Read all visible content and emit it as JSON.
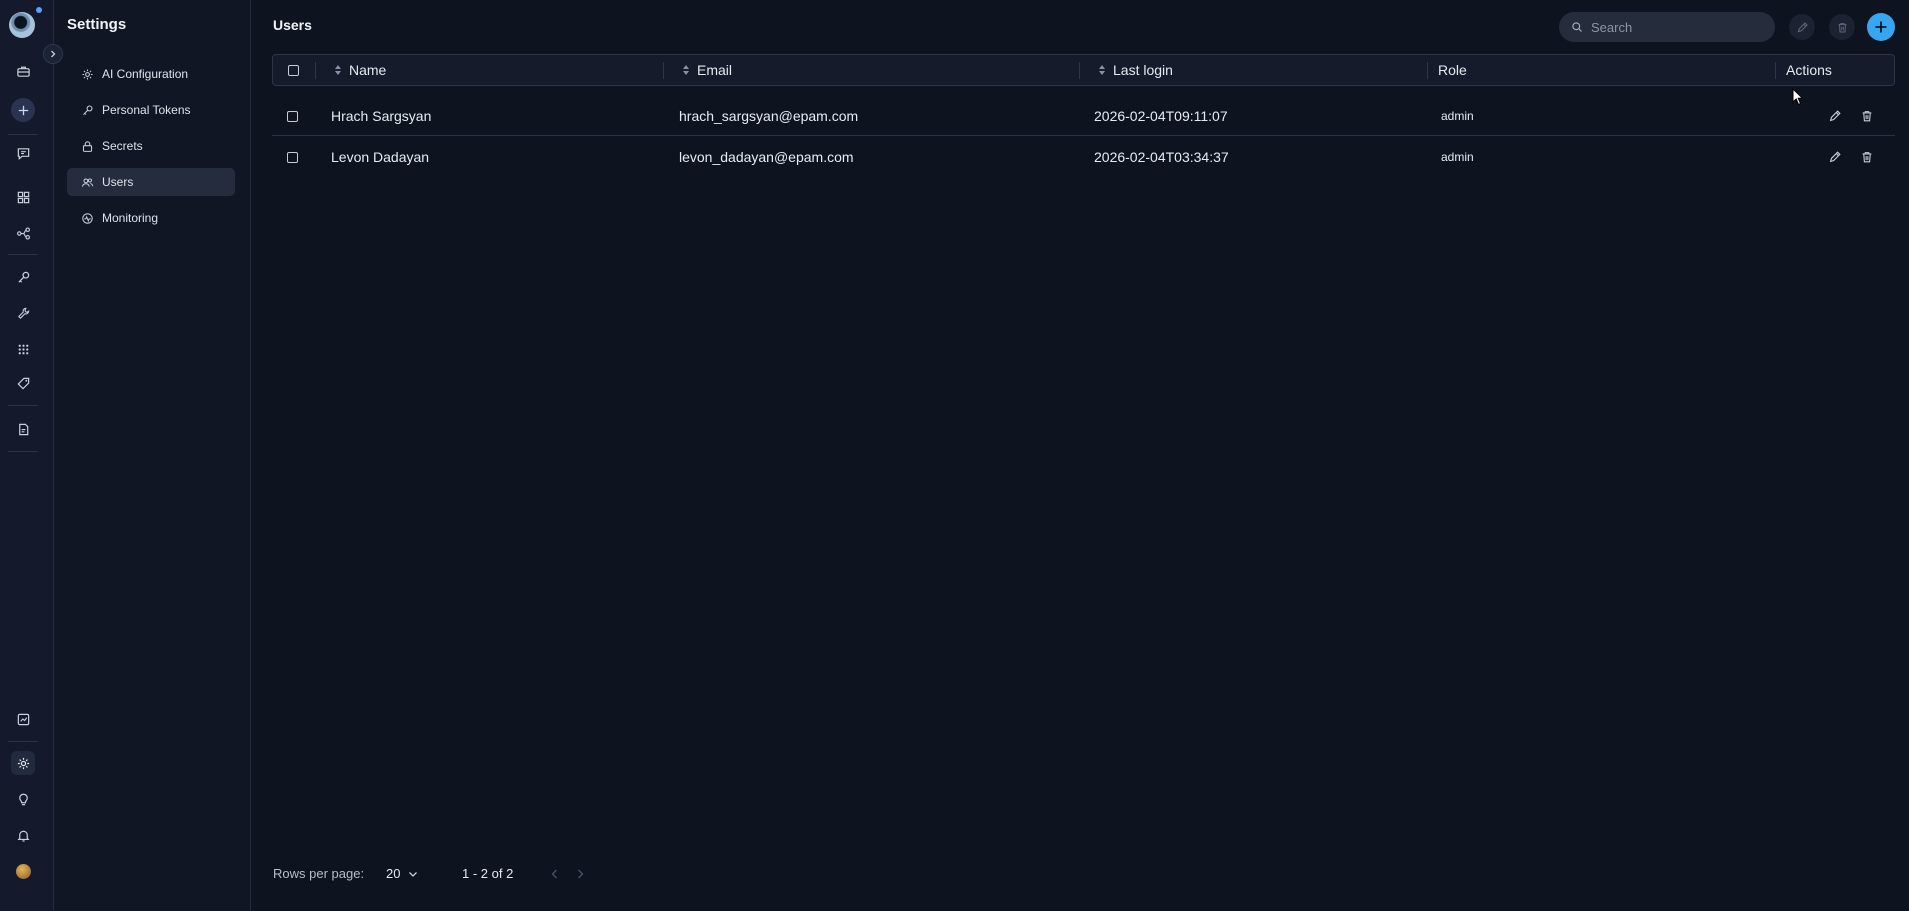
{
  "sidebar": {
    "title": "Settings",
    "items": [
      {
        "label": "AI Configuration",
        "icon": "gear-icon"
      },
      {
        "label": "Personal Tokens",
        "icon": "key-icon"
      },
      {
        "label": "Secrets",
        "icon": "lock-icon"
      },
      {
        "label": "Users",
        "icon": "users-icon",
        "active": true
      },
      {
        "label": "Monitoring",
        "icon": "monitoring-icon"
      }
    ]
  },
  "header": {
    "title": "Users",
    "search_placeholder": "Search"
  },
  "table": {
    "columns": [
      "Name",
      "Email",
      "Last login",
      "Role",
      "Actions"
    ],
    "rows": [
      {
        "name": "Hrach Sargsyan",
        "email": "hrach_sargsyan@epam.com",
        "last_login": "2026-02-04T09:11:07",
        "role": "admin"
      },
      {
        "name": "Levon Dadayan",
        "email": "levon_dadayan@epam.com",
        "last_login": "2026-02-04T03:34:37",
        "role": "admin"
      }
    ]
  },
  "pagination": {
    "rows_per_page_label": "Rows per page:",
    "rows_per_page": "20",
    "range": "1 - 2 of 2"
  },
  "colors": {
    "accent": "#37a6f0",
    "background": "#0e1320",
    "sidebar": "#101624"
  }
}
